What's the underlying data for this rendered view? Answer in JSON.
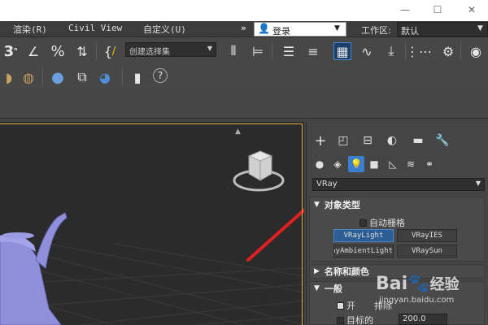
{
  "menubar": {
    "items": [
      "渲染(R)",
      "Civil View",
      "自定义(U)"
    ],
    "overflow": "»",
    "login": "登录",
    "workspace_label": "工作区:",
    "workspace_value": "默认"
  },
  "toolbar": {
    "selection_set_placeholder": "创建选择集",
    "snap_3": "3",
    "percent_snap": "%",
    "curly": "{"
  },
  "command_panel": {
    "category_value": "VRay",
    "object_type": {
      "title": "对象类型",
      "auto_grid": "自动栅格",
      "buttons": [
        "VRayLight",
        "VRayIES",
        "VRayAmbientLight",
        "VRaySun"
      ]
    },
    "name_color": {
      "title": "名称和颜色"
    },
    "general": {
      "title": "一般",
      "on_label": "开",
      "exclude_label": "排除",
      "target_label": "目标的",
      "target_value": "200.0"
    }
  },
  "watermark": {
    "brand": "Bai",
    "brand2": "经验",
    "url": "jingyan.baidu.com"
  },
  "colors": {
    "accent": "#3a7ed0",
    "arrow": "#e02020",
    "teapot": "#8f8fdc"
  }
}
